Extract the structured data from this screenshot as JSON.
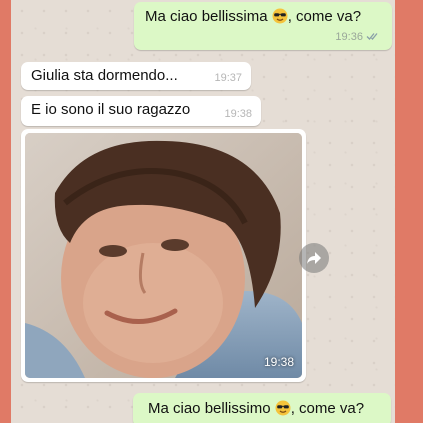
{
  "messages": [
    {
      "text_before": "Ma ciao bellissima",
      "text_after": ", come va?",
      "emoji": "smiling-face-with-sunglasses",
      "time": "19:36",
      "status": "double-check-icon"
    },
    {
      "text": "Giulia sta dormendo...",
      "time": "19:37"
    },
    {
      "text": "E io sono il suo ragazzo",
      "time": "19:38"
    },
    {
      "type": "photo",
      "time": "19:38"
    },
    {
      "text_before": "Ma ciao bellissimo",
      "text_after": ", come va?",
      "emoji": "smiling-face-with-sunglasses"
    }
  ],
  "icons": {
    "forward": "forward-icon"
  },
  "colors": {
    "outgoing_bubble": "#dcf8c6",
    "incoming_bubble": "#ffffff",
    "chat_background": "#e5ddd5",
    "frame": "#e07a66"
  }
}
